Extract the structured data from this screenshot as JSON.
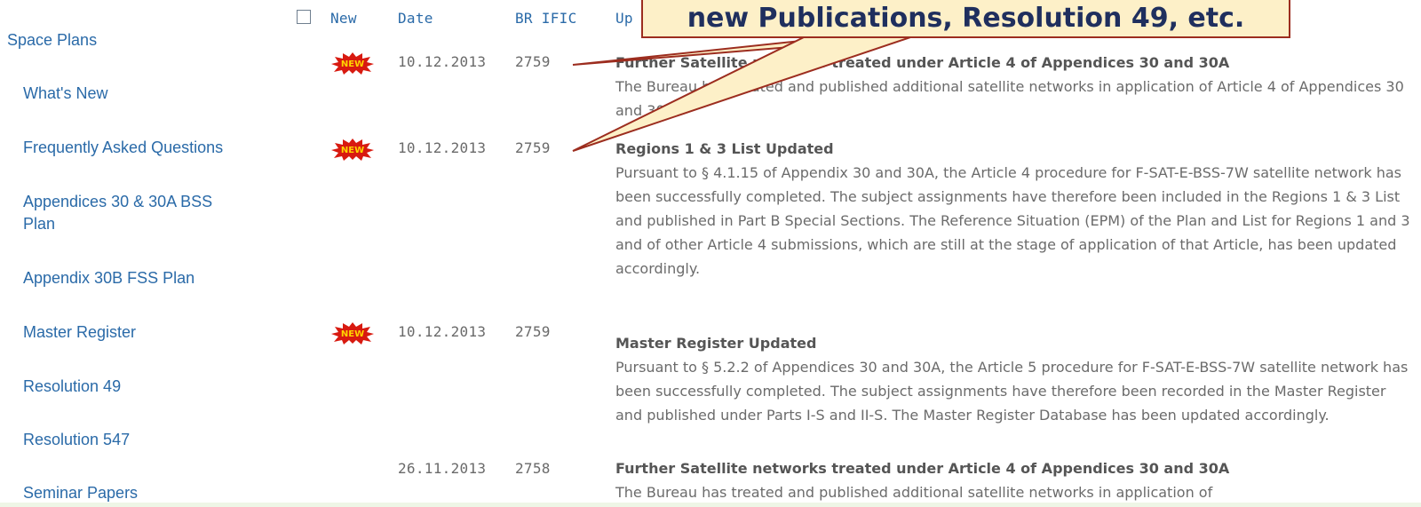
{
  "sidebar": {
    "title": "Space Plans",
    "items": [
      {
        "label": "What's New"
      },
      {
        "label": "Frequently Asked Questions"
      },
      {
        "label": "Appendices 30 & 30A BSS Plan"
      },
      {
        "label": "Appendix 30B FSS Plan"
      },
      {
        "label": "Master Register"
      },
      {
        "label": "Resolution 49"
      },
      {
        "label": "Resolution 547"
      },
      {
        "label": "Seminar Papers"
      }
    ]
  },
  "table": {
    "headers": {
      "new": "New",
      "date": "Date",
      "br_ific": "BR IFIC",
      "update": "Up"
    },
    "new_badge_text": "NEW",
    "rows": [
      {
        "date": "10.12.2013",
        "ific": "2759",
        "title": "Further Satellite networks treated under Article 4 of Appendices 30 and 30A",
        "body": " The Bureau has treated and published additional satellite networks in application of Article 4 of Appendices 30 and 30A."
      },
      {
        "date": "10.12.2013",
        "ific": "2759",
        "title": "Regions 1 & 3 List Updated",
        "body": " Pursuant to § 4.1.15 of Appendix 30 and 30A, the Article 4 procedure for F-SAT-E-BSS-7W satellite network has been successfully completed. The subject assignments have therefore been included in the Regions 1 & 3 List and published in Part B Special Sections. The Reference Situation (EPM) of the Plan and List for Regions 1 and 3 and of other Article 4 submissions, which are still at the stage of application of that Article, has been updated accordingly."
      },
      {
        "date": "10.12.2013",
        "ific": "2759",
        "title": "Master Register Updated",
        "body": " Pursuant to § 5.2.2 of Appendices 30 and 30A, the Article 5 procedure for F-SAT-E-BSS-7W satellite network has been successfully completed. The subject assignments have therefore been recorded in the Master Register and published under Parts I-S and II-S. The Master Register Database has been updated accordingly."
      },
      {
        "date": "26.11.2013",
        "ific": "2758",
        "title": "Further Satellite networks treated under Article 4 of Appendices 30 and 30A",
        "body": " The Bureau has treated and published additional satellite networks in application of"
      }
    ]
  },
  "callout": {
    "text": "new Publications, Resolution 49, etc."
  },
  "colors": {
    "link": "#2a6aa8",
    "callout_fill": "#fdf0c8",
    "callout_border": "#9c2d1f",
    "callout_text": "#1f2f5e",
    "badge_red": "#d81a10",
    "badge_yellow": "#ffd400"
  }
}
